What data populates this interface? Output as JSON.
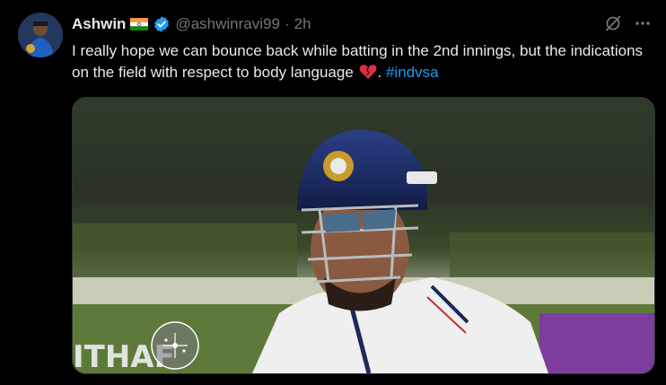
{
  "tweet": {
    "author_name": "Ashwin",
    "handle": "@ashwinravi99",
    "separator": "·",
    "time": "2h",
    "text_part1": "I really hope we can bounce back while batting in the 2nd innings, but the indications on the field with respect to body language",
    "text_part2": ".",
    "hashtag": "#indvsa"
  },
  "icons": {
    "flag": "india-flag-icon",
    "verified": "verified-badge-icon",
    "grok": "grok-icon",
    "more": "more-options-icon",
    "emoji": "broken-heart-icon"
  },
  "colors": {
    "background": "#000000",
    "text": "#e7e9ea",
    "muted": "#71767b",
    "link": "#1d9bf0",
    "verified": "#1d9bf0"
  }
}
